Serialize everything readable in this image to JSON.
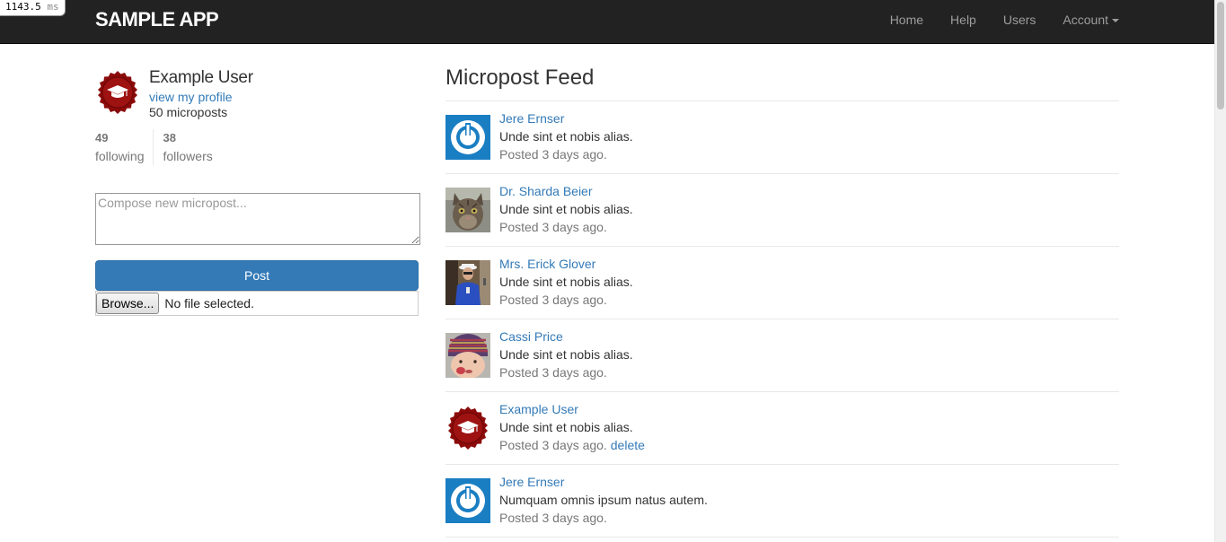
{
  "perf": {
    "value": "1143.5",
    "unit": "ms"
  },
  "header": {
    "brand": "SAMPLE APP",
    "nav": [
      {
        "label": "Home"
      },
      {
        "label": "Help"
      },
      {
        "label": "Users"
      },
      {
        "label": "Account"
      }
    ]
  },
  "sidebar": {
    "user_name": "Example User",
    "profile_link": "view my profile",
    "micropost_count": "50 microposts",
    "stats": {
      "following_count": "49",
      "following_label": "following",
      "followers_count": "38",
      "followers_label": "followers"
    },
    "compose_placeholder": "Compose new micropost...",
    "post_button": "Post",
    "browse_button": "Browse...",
    "file_status": "No file selected."
  },
  "feed": {
    "title": "Micropost Feed",
    "posts": [
      {
        "user": "Jere Ernser",
        "content": "Unde sint et nobis alias.",
        "time": "Posted 3 days ago.",
        "avatar": "power-logo-avatar"
      },
      {
        "user": "Dr. Sharda Beier",
        "content": "Unde sint et nobis alias.",
        "time": "Posted 3 days ago.",
        "avatar": "cat-photo-avatar"
      },
      {
        "user": "Mrs. Erick Glover",
        "content": "Unde sint et nobis alias.",
        "time": "Posted 3 days ago.",
        "avatar": "person-photo-avatar"
      },
      {
        "user": "Cassi Price",
        "content": "Unde sint et nobis alias.",
        "time": "Posted 3 days ago.",
        "avatar": "child-photo-avatar"
      },
      {
        "user": "Example User",
        "content": "Unde sint et nobis alias.",
        "time": "Posted 3 days ago.",
        "delete": "delete",
        "avatar": "graduation-cap-avatar"
      },
      {
        "user": "Jere Ernser",
        "content": "Numquam omnis ipsum natus autem.",
        "time": "Posted 3 days ago.",
        "avatar": "power-logo-avatar"
      }
    ]
  },
  "colors": {
    "navbar_bg": "#222222",
    "link": "#337ab7",
    "primary_button": "#337ab7",
    "avatar_red": "#8b0a0a",
    "avatar_blue": "#1a7ec2"
  }
}
